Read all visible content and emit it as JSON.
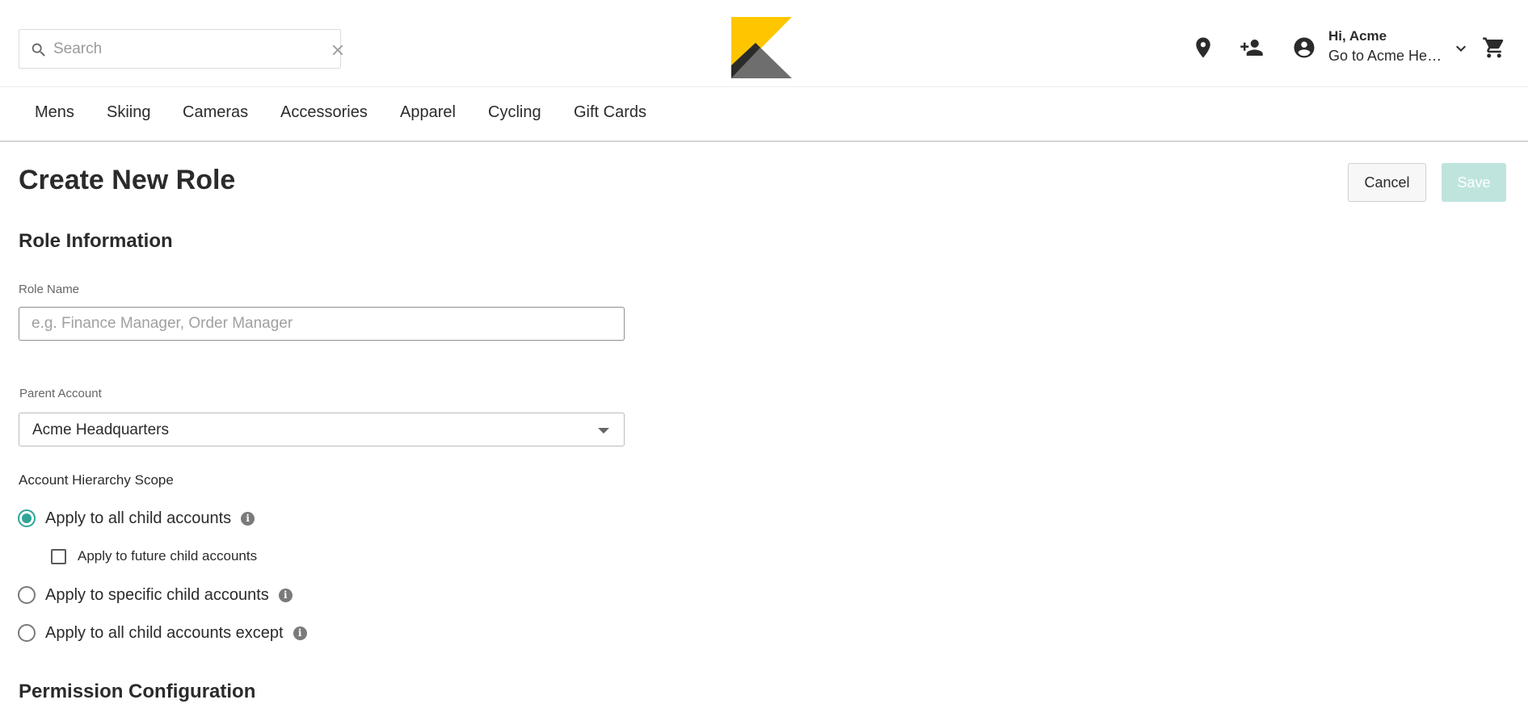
{
  "header": {
    "search_placeholder": "Search",
    "account": {
      "greeting": "Hi, Acme",
      "goto_label": "Go to Acme Headquarters"
    },
    "icons": [
      "search-icon",
      "close-icon",
      "store-location-icon",
      "add-user-icon",
      "account-circle-icon",
      "chevron-down-icon",
      "cart-icon"
    ]
  },
  "nav": {
    "items": [
      "Mens",
      "Skiing",
      "Cameras",
      "Accessories",
      "Apparel",
      "Cycling",
      "Gift Cards"
    ]
  },
  "page": {
    "title": "Create New Role",
    "cancel_label": "Cancel",
    "save_label": "Save"
  },
  "role_info": {
    "section_title": "Role Information",
    "role_name_label": "Role Name",
    "role_name_value": "",
    "role_name_placeholder": "e.g. Finance Manager, Order Manager",
    "parent_account_label": "Parent Account",
    "parent_account_value": "Acme Headquarters",
    "scope_label": "Account Hierarchy Scope",
    "scope_options": [
      {
        "label": "Apply to all child accounts",
        "selected": true
      },
      {
        "label": "Apply to specific child accounts",
        "selected": false
      },
      {
        "label": "Apply to all child accounts except",
        "selected": false
      }
    ],
    "future_children_label": "Apply to future child accounts",
    "future_children_checked": false
  },
  "permissions": {
    "section_title": "Permission Configuration"
  },
  "colors": {
    "accent": "#2ea597",
    "save_disabled": "#bfe4de",
    "logo_yellow": "#ffc600",
    "logo_gray": "#6e6e6e"
  }
}
